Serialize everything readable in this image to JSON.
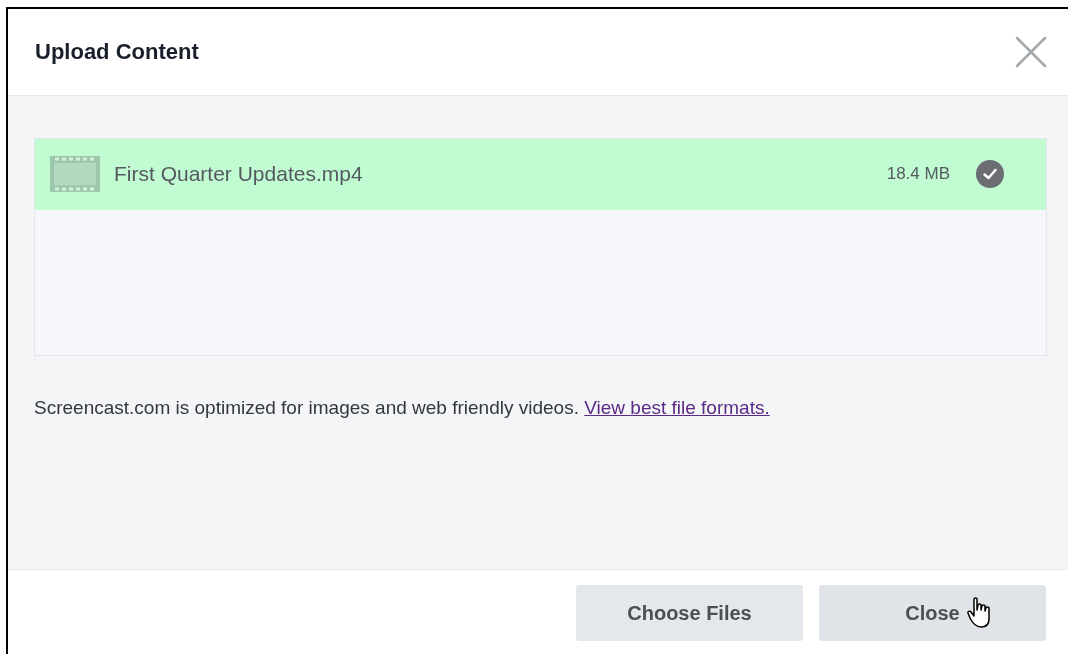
{
  "dialog": {
    "title": "Upload Content"
  },
  "files": [
    {
      "name": "First Quarter Updates.mp4",
      "size": "18.4 MB",
      "complete": true
    }
  ],
  "notice": {
    "text": "Screencast.com is optimized for images and web friendly videos.",
    "link": "View best file formats."
  },
  "buttons": [
    {
      "label": "Choose Files",
      "hovered": false
    },
    {
      "label": "Close",
      "hovered": true
    }
  ]
}
